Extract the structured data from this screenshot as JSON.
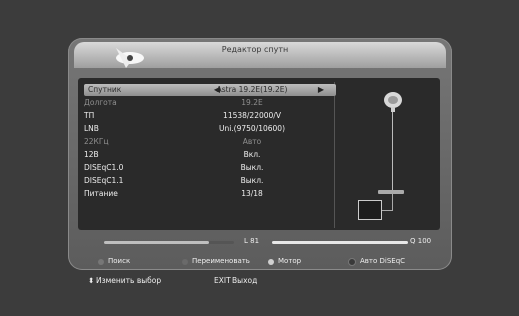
{
  "header": {
    "title": "Редактор спутн"
  },
  "rows": [
    {
      "label": "Спутник",
      "value": "Astra 19.2E(19.2E)"
    },
    {
      "label": "Долгота",
      "value": "19.2E"
    },
    {
      "label": "ТП",
      "value": "11538/22000/V"
    },
    {
      "label": "LNB",
      "value": "Uni.(9750/10600)"
    },
    {
      "label": "22КГц",
      "value": "Авто"
    },
    {
      "label": "12В",
      "value": "Вкл."
    },
    {
      "label": "DISEqC1.0",
      "value": "Выкл."
    },
    {
      "label": "DISEqC1.1",
      "value": "Выкл."
    },
    {
      "label": "Питание",
      "value": "13/18"
    }
  ],
  "signal": {
    "level_label": "L 81",
    "level_value": 81,
    "quality_label": "Q 100",
    "quality_value": 100
  },
  "footer": {
    "search": "Поиск",
    "rename": "Переименовать",
    "motor": "Мотор",
    "auto": "Авто DiSEqC"
  },
  "bottom": {
    "change": "Изменить выбор",
    "exit_key": "EXIT",
    "exit_label": "Выход"
  },
  "colors": {
    "red": "#777777",
    "green": "#6a6a6a",
    "yellow": "#d0d0d0",
    "blue": "#3a3a3a"
  },
  "icons": {
    "left": "left-arrow-icon",
    "right": "right-arrow-icon"
  }
}
